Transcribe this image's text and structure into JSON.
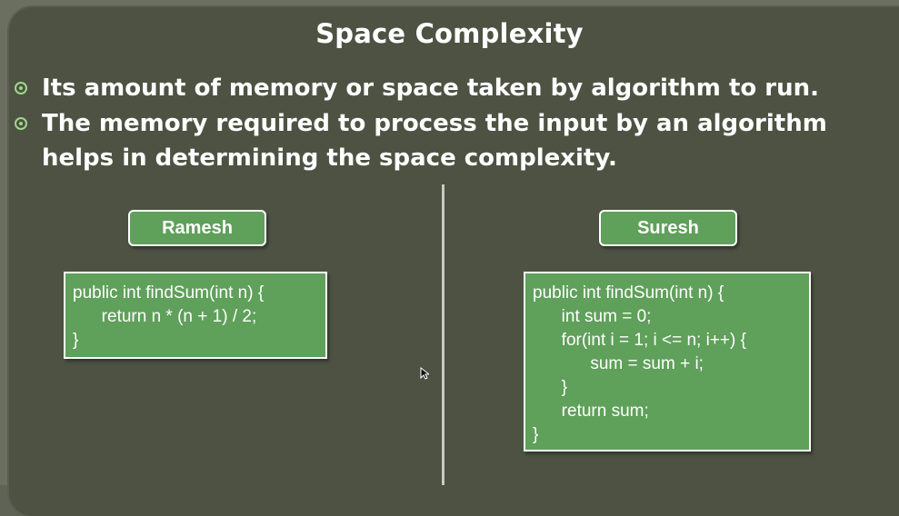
{
  "slide": {
    "title": "Space Complexity",
    "bullets": [
      "Its amount of memory or space taken by algorithm to run.",
      "The memory required to process the input by an algorithm helps in determining the space complexity."
    ],
    "left": {
      "label": "Ramesh",
      "code": [
        "public int findSum(int n) {",
        "      return n * (n + 1) / 2;",
        "}"
      ]
    },
    "right": {
      "label": "Suresh",
      "code": [
        "public int findSum(int n) {",
        "      int sum = 0;",
        "      for(int i = 1; i <= n; i++) {",
        "            sum = sum + i;",
        "      }",
        "      return sum;",
        "}"
      ]
    }
  },
  "colors": {
    "background": "#4d5243",
    "box_fill": "#5fa05a",
    "bullet_accent": "#9fd68a",
    "text": "#ffffff"
  },
  "icons": [
    "bullet-circle-icon",
    "mouse-cursor-icon"
  ]
}
